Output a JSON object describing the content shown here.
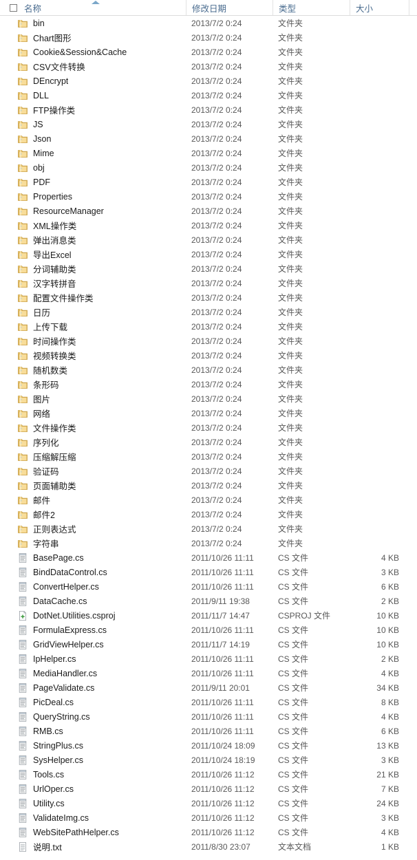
{
  "header": {
    "columns": [
      {
        "label": "名称",
        "key": "name"
      },
      {
        "label": "修改日期",
        "key": "date"
      },
      {
        "label": "类型",
        "key": "type"
      },
      {
        "label": "大小",
        "key": "size"
      }
    ],
    "sort_column": "名称",
    "sort_direction": "ascending",
    "select_all_checked": false
  },
  "colors": {
    "header_text": "#4a6c8f",
    "row_text": "#1a1a1a",
    "meta_text": "#585858",
    "folder_icon": "#f3d07a",
    "sort_arrow": "#7ba7c9",
    "divider": "#e2e2e2",
    "background": "#ffffff"
  },
  "type_labels": {
    "folder": "文件夹",
    "cs": "CS 文件",
    "csproj": "CSPROJ 文件",
    "txt": "文本文档"
  },
  "rows": [
    {
      "name": "bin",
      "date": "2013/7/2 0:24",
      "type": "文件夹",
      "size": "",
      "icon": "folder-icon"
    },
    {
      "name": "Chart图形",
      "date": "2013/7/2 0:24",
      "type": "文件夹",
      "size": "",
      "icon": "folder-icon"
    },
    {
      "name": "Cookie&Session&Cache",
      "date": "2013/7/2 0:24",
      "type": "文件夹",
      "size": "",
      "icon": "folder-icon"
    },
    {
      "name": "CSV文件转换",
      "date": "2013/7/2 0:24",
      "type": "文件夹",
      "size": "",
      "icon": "folder-icon"
    },
    {
      "name": "DEncrypt",
      "date": "2013/7/2 0:24",
      "type": "文件夹",
      "size": "",
      "icon": "folder-icon"
    },
    {
      "name": "DLL",
      "date": "2013/7/2 0:24",
      "type": "文件夹",
      "size": "",
      "icon": "folder-icon"
    },
    {
      "name": "FTP操作类",
      "date": "2013/7/2 0:24",
      "type": "文件夹",
      "size": "",
      "icon": "folder-icon"
    },
    {
      "name": "JS",
      "date": "2013/7/2 0:24",
      "type": "文件夹",
      "size": "",
      "icon": "folder-icon"
    },
    {
      "name": "Json",
      "date": "2013/7/2 0:24",
      "type": "文件夹",
      "size": "",
      "icon": "folder-icon"
    },
    {
      "name": "Mime",
      "date": "2013/7/2 0:24",
      "type": "文件夹",
      "size": "",
      "icon": "folder-icon"
    },
    {
      "name": "obj",
      "date": "2013/7/2 0:24",
      "type": "文件夹",
      "size": "",
      "icon": "folder-icon"
    },
    {
      "name": "PDF",
      "date": "2013/7/2 0:24",
      "type": "文件夹",
      "size": "",
      "icon": "folder-icon"
    },
    {
      "name": "Properties",
      "date": "2013/7/2 0:24",
      "type": "文件夹",
      "size": "",
      "icon": "folder-icon"
    },
    {
      "name": "ResourceManager",
      "date": "2013/7/2 0:24",
      "type": "文件夹",
      "size": "",
      "icon": "folder-icon"
    },
    {
      "name": "XML操作类",
      "date": "2013/7/2 0:24",
      "type": "文件夹",
      "size": "",
      "icon": "folder-icon"
    },
    {
      "name": "弹出消息类",
      "date": "2013/7/2 0:24",
      "type": "文件夹",
      "size": "",
      "icon": "folder-icon"
    },
    {
      "name": "导出Excel",
      "date": "2013/7/2 0:24",
      "type": "文件夹",
      "size": "",
      "icon": "folder-icon"
    },
    {
      "name": "分词辅助类",
      "date": "2013/7/2 0:24",
      "type": "文件夹",
      "size": "",
      "icon": "folder-icon"
    },
    {
      "name": "汉字转拼音",
      "date": "2013/7/2 0:24",
      "type": "文件夹",
      "size": "",
      "icon": "folder-icon"
    },
    {
      "name": "配置文件操作类",
      "date": "2013/7/2 0:24",
      "type": "文件夹",
      "size": "",
      "icon": "folder-icon"
    },
    {
      "name": "日历",
      "date": "2013/7/2 0:24",
      "type": "文件夹",
      "size": "",
      "icon": "folder-icon"
    },
    {
      "name": "上传下载",
      "date": "2013/7/2 0:24",
      "type": "文件夹",
      "size": "",
      "icon": "folder-icon"
    },
    {
      "name": "时间操作类",
      "date": "2013/7/2 0:24",
      "type": "文件夹",
      "size": "",
      "icon": "folder-icon"
    },
    {
      "name": "视频转换类",
      "date": "2013/7/2 0:24",
      "type": "文件夹",
      "size": "",
      "icon": "folder-icon"
    },
    {
      "name": "随机数类",
      "date": "2013/7/2 0:24",
      "type": "文件夹",
      "size": "",
      "icon": "folder-icon"
    },
    {
      "name": "条形码",
      "date": "2013/7/2 0:24",
      "type": "文件夹",
      "size": "",
      "icon": "folder-icon"
    },
    {
      "name": "图片",
      "date": "2013/7/2 0:24",
      "type": "文件夹",
      "size": "",
      "icon": "folder-icon"
    },
    {
      "name": "网络",
      "date": "2013/7/2 0:24",
      "type": "文件夹",
      "size": "",
      "icon": "folder-icon"
    },
    {
      "name": "文件操作类",
      "date": "2013/7/2 0:24",
      "type": "文件夹",
      "size": "",
      "icon": "folder-icon"
    },
    {
      "name": "序列化",
      "date": "2013/7/2 0:24",
      "type": "文件夹",
      "size": "",
      "icon": "folder-icon"
    },
    {
      "name": "压缩解压缩",
      "date": "2013/7/2 0:24",
      "type": "文件夹",
      "size": "",
      "icon": "folder-icon"
    },
    {
      "name": "验证码",
      "date": "2013/7/2 0:24",
      "type": "文件夹",
      "size": "",
      "icon": "folder-icon"
    },
    {
      "name": "页面辅助类",
      "date": "2013/7/2 0:24",
      "type": "文件夹",
      "size": "",
      "icon": "folder-icon"
    },
    {
      "name": "邮件",
      "date": "2013/7/2 0:24",
      "type": "文件夹",
      "size": "",
      "icon": "folder-icon"
    },
    {
      "name": "邮件2",
      "date": "2013/7/2 0:24",
      "type": "文件夹",
      "size": "",
      "icon": "folder-icon"
    },
    {
      "name": "正则表达式",
      "date": "2013/7/2 0:24",
      "type": "文件夹",
      "size": "",
      "icon": "folder-icon"
    },
    {
      "name": "字符串",
      "date": "2013/7/2 0:24",
      "type": "文件夹",
      "size": "",
      "icon": "folder-icon"
    },
    {
      "name": "BasePage.cs",
      "date": "2011/10/26 11:11",
      "type": "CS 文件",
      "size": "4 KB",
      "icon": "cs-file-icon"
    },
    {
      "name": "BindDataControl.cs",
      "date": "2011/10/26 11:11",
      "type": "CS 文件",
      "size": "3 KB",
      "icon": "cs-file-icon"
    },
    {
      "name": "ConvertHelper.cs",
      "date": "2011/10/26 11:11",
      "type": "CS 文件",
      "size": "6 KB",
      "icon": "cs-file-icon"
    },
    {
      "name": "DataCache.cs",
      "date": "2011/9/11 19:38",
      "type": "CS 文件",
      "size": "2 KB",
      "icon": "cs-file-icon"
    },
    {
      "name": "DotNet.Utilities.csproj",
      "date": "2011/11/7 14:47",
      "type": "CSPROJ 文件",
      "size": "10 KB",
      "icon": "csproj-file-icon"
    },
    {
      "name": "FormulaExpress.cs",
      "date": "2011/10/26 11:11",
      "type": "CS 文件",
      "size": "10 KB",
      "icon": "cs-file-icon"
    },
    {
      "name": "GridViewHelper.cs",
      "date": "2011/11/7 14:19",
      "type": "CS 文件",
      "size": "10 KB",
      "icon": "cs-file-icon"
    },
    {
      "name": "IpHelper.cs",
      "date": "2011/10/26 11:11",
      "type": "CS 文件",
      "size": "2 KB",
      "icon": "cs-file-icon"
    },
    {
      "name": "MediaHandler.cs",
      "date": "2011/10/26 11:11",
      "type": "CS 文件",
      "size": "4 KB",
      "icon": "cs-file-icon"
    },
    {
      "name": "PageValidate.cs",
      "date": "2011/9/11 20:01",
      "type": "CS 文件",
      "size": "34 KB",
      "icon": "cs-file-icon"
    },
    {
      "name": "PicDeal.cs",
      "date": "2011/10/26 11:11",
      "type": "CS 文件",
      "size": "8 KB",
      "icon": "cs-file-icon"
    },
    {
      "name": "QueryString.cs",
      "date": "2011/10/26 11:11",
      "type": "CS 文件",
      "size": "4 KB",
      "icon": "cs-file-icon"
    },
    {
      "name": "RMB.cs",
      "date": "2011/10/26 11:11",
      "type": "CS 文件",
      "size": "6 KB",
      "icon": "cs-file-icon"
    },
    {
      "name": "StringPlus.cs",
      "date": "2011/10/24 18:09",
      "type": "CS 文件",
      "size": "13 KB",
      "icon": "cs-file-icon"
    },
    {
      "name": "SysHelper.cs",
      "date": "2011/10/24 18:19",
      "type": "CS 文件",
      "size": "3 KB",
      "icon": "cs-file-icon"
    },
    {
      "name": "Tools.cs",
      "date": "2011/10/26 11:12",
      "type": "CS 文件",
      "size": "21 KB",
      "icon": "cs-file-icon"
    },
    {
      "name": "UrlOper.cs",
      "date": "2011/10/26 11:12",
      "type": "CS 文件",
      "size": "7 KB",
      "icon": "cs-file-icon"
    },
    {
      "name": "Utility.cs",
      "date": "2011/10/26 11:12",
      "type": "CS 文件",
      "size": "24 KB",
      "icon": "cs-file-icon"
    },
    {
      "name": "ValidateImg.cs",
      "date": "2011/10/26 11:12",
      "type": "CS 文件",
      "size": "3 KB",
      "icon": "cs-file-icon"
    },
    {
      "name": "WebSitePathHelper.cs",
      "date": "2011/10/26 11:12",
      "type": "CS 文件",
      "size": "4 KB",
      "icon": "cs-file-icon"
    },
    {
      "name": "说明.txt",
      "date": "2011/8/30 23:07",
      "type": "文本文档",
      "size": "1 KB",
      "icon": "txt-file-icon"
    }
  ]
}
